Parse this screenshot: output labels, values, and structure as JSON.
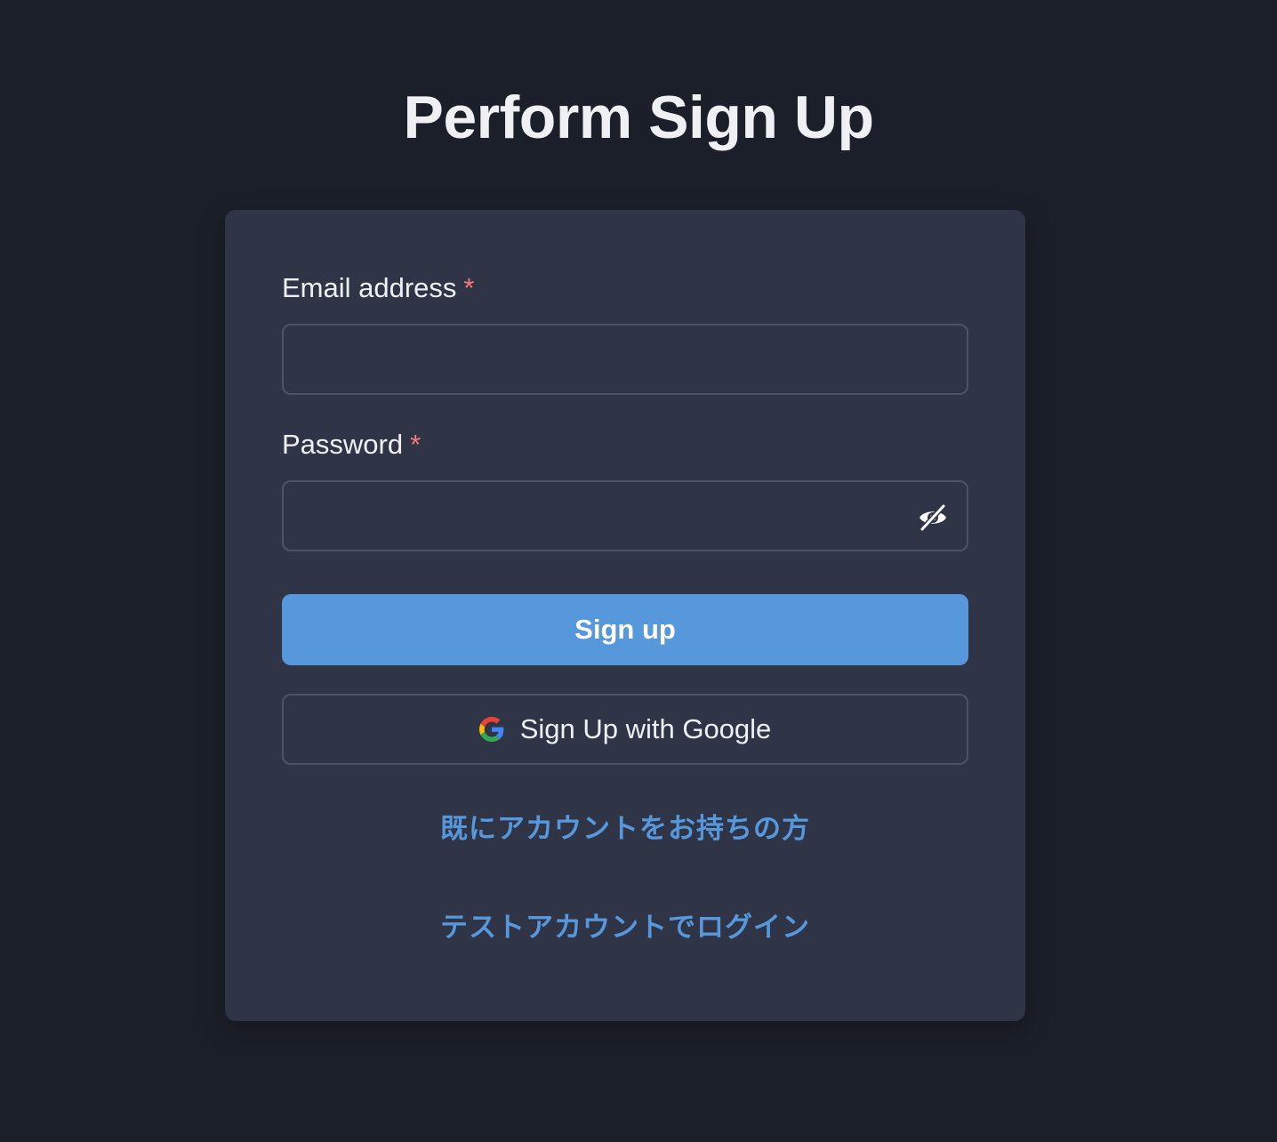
{
  "page": {
    "title": "Perform Sign Up"
  },
  "form": {
    "email": {
      "label": "Email address",
      "required_mark": "*",
      "value": "",
      "placeholder": ""
    },
    "password": {
      "label": "Password",
      "required_mark": "*",
      "value": "",
      "placeholder": "",
      "toggle_icon": "eye-off-icon"
    },
    "submit_label": "Sign up",
    "google_label": "Sign Up with Google",
    "google_icon": "google-icon"
  },
  "links": {
    "have_account": "既にアカウントをお持ちの方",
    "test_account_login": "テストアカウントでログイン"
  },
  "colors": {
    "background": "#1b1f29",
    "card": "#2f3546",
    "accent": "#5797dc",
    "required": "#f47b7b",
    "border": "#4c5366"
  }
}
